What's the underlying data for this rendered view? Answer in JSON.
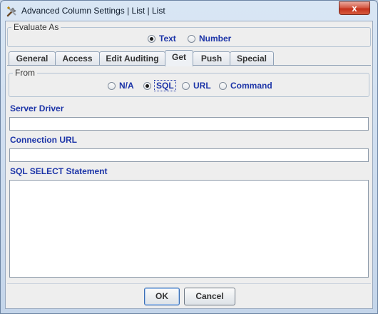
{
  "window": {
    "title": "Advanced Column Settings | List | List",
    "close_label": "x"
  },
  "evaluate_as": {
    "legend": "Evaluate As",
    "options": [
      {
        "label": "Text",
        "checked": true
      },
      {
        "label": "Number",
        "checked": false
      }
    ]
  },
  "tabs": [
    {
      "label": "General",
      "selected": false
    },
    {
      "label": "Access",
      "selected": false
    },
    {
      "label": "Edit Auditing",
      "selected": false
    },
    {
      "label": "Get",
      "selected": true
    },
    {
      "label": "Push",
      "selected": false
    },
    {
      "label": "Special",
      "selected": false
    }
  ],
  "get_tab": {
    "from": {
      "legend": "From",
      "options": [
        {
          "label": "N/A",
          "checked": false
        },
        {
          "label": "SQL",
          "checked": true
        },
        {
          "label": "URL",
          "checked": false
        },
        {
          "label": "Command",
          "checked": false
        }
      ]
    },
    "server_driver": {
      "label": "Server Driver",
      "value": ""
    },
    "connection_url": {
      "label": "Connection URL",
      "value": ""
    },
    "sql_select": {
      "label": "SQL SELECT Statement",
      "value": ""
    }
  },
  "buttons": {
    "ok": "OK",
    "cancel": "Cancel"
  },
  "colors": {
    "label_blue": "#1d35a8",
    "close_red": "#c4311c"
  }
}
